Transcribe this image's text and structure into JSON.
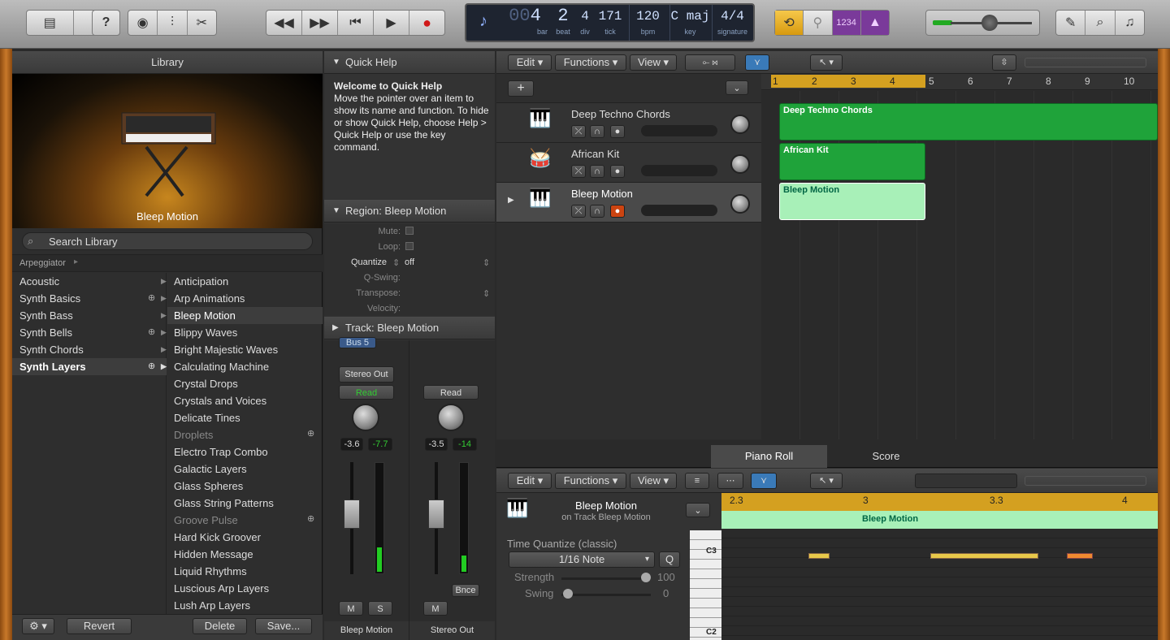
{
  "toolbar": {
    "lcd": {
      "bar": "4",
      "bar_prefix": "00",
      "beat": "2",
      "div": "4",
      "tick": "171",
      "bpm": "120",
      "key": "C maj",
      "signature": "4/4",
      "labels": {
        "bar": "bar",
        "beat": "beat",
        "div": "div",
        "tick": "tick",
        "bpm": "bpm",
        "key": "key",
        "signature": "signature"
      }
    },
    "count_in": "1234"
  },
  "library": {
    "title": "Library",
    "patch_name": "Bleep Motion",
    "search_placeholder": "Search Library",
    "breadcrumb": "Arpeggiator",
    "categories": [
      {
        "label": "Acoustic"
      },
      {
        "label": "Synth Basics"
      },
      {
        "label": "Synth Bass"
      },
      {
        "label": "Synth Bells"
      },
      {
        "label": "Synth Chords"
      },
      {
        "label": "Synth Layers"
      }
    ],
    "patches": [
      "Anticipation",
      "Arp Animations",
      "Bleep Motion",
      "Blippy Waves",
      "Bright Majestic Waves",
      "Calculating Machine",
      "Crystal Drops",
      "Crystals and Voices",
      "Delicate Tines",
      "Droplets",
      "Electro Trap Combo",
      "Galactic Layers",
      "Glass Spheres",
      "Glass String Patterns",
      "Groove Pulse",
      "Hard Kick Groover",
      "Hidden Message",
      "Liquid Rhythms",
      "Luscious Arp Layers",
      "Lush Arp Layers"
    ],
    "footer": {
      "revert": "Revert",
      "delete": "Delete",
      "save": "Save..."
    }
  },
  "quickhelp": {
    "title": "Quick Help",
    "heading": "Welcome to Quick Help",
    "body": "Move the pointer over an item to show its name and function. To hide or show Quick Help, choose Help > Quick Help or use the key command.",
    "region_title": "Region: Bleep Motion",
    "params": {
      "mute": "Mute:",
      "loop": "Loop:",
      "quantize": "Quantize",
      "quantize_val": "off",
      "qswing": "Q-Swing:",
      "transpose": "Transpose:",
      "velocity": "Velocity:"
    },
    "track_title": "Track:  Bleep Motion"
  },
  "mixer": {
    "bus": "Bus 5",
    "output": "Stereo Out",
    "read": "Read",
    "ch1": {
      "name": "Bleep Motion",
      "vol": "-3.6",
      "peak": "-7.7",
      "m": "M",
      "s": "S"
    },
    "ch2": {
      "name": "Stereo Out",
      "vol": "-3.5",
      "peak": "-14",
      "m": "M",
      "bnce": "Bnce"
    }
  },
  "tracks": {
    "menu": {
      "edit": "Edit",
      "functions": "Functions",
      "view": "View"
    },
    "ruler": [
      "1",
      "2",
      "3",
      "4",
      "5",
      "6",
      "7",
      "8",
      "9",
      "10"
    ],
    "list": [
      {
        "name": "Deep Techno Chords"
      },
      {
        "name": "African Kit"
      },
      {
        "name": "Bleep Motion"
      }
    ]
  },
  "editor": {
    "tabs": {
      "piano": "Piano Roll",
      "score": "Score"
    },
    "menu": {
      "edit": "Edit",
      "functions": "Functions",
      "view": "View"
    },
    "region_name": "Bleep Motion",
    "region_sub": "on Track Bleep Motion",
    "tq_label": "Time Quantize (classic)",
    "tq_value": "1/16 Note",
    "q": "Q",
    "strength_label": "Strength",
    "strength_val": "100",
    "swing_label": "Swing",
    "swing_val": "0",
    "ruler": [
      "2.3",
      "3",
      "3.3",
      "4"
    ],
    "c3": "C3",
    "c2": "C2"
  }
}
